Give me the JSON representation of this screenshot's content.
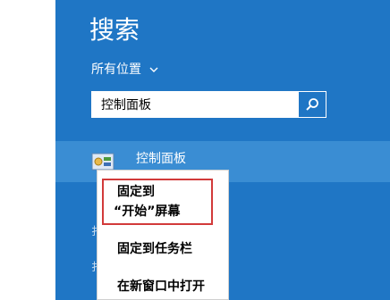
{
  "search_pane": {
    "title": "搜索",
    "scope_label": "所有位置",
    "search_value": "控制面板"
  },
  "results": [
    {
      "label": "控制面板",
      "icon": "control-panel-icon"
    }
  ],
  "context_menu": {
    "items": [
      {
        "line1": "固定到",
        "line2": "“开始”屏幕"
      },
      {
        "label": "固定到任务栏"
      },
      {
        "label": "在新窗口中打开"
      }
    ]
  },
  "colors": {
    "pane_bg": "#1f76c5",
    "result_highlight": "#3a8dd3",
    "menu_bg": "#ffffff",
    "annotation_red": "#d23a3a"
  }
}
